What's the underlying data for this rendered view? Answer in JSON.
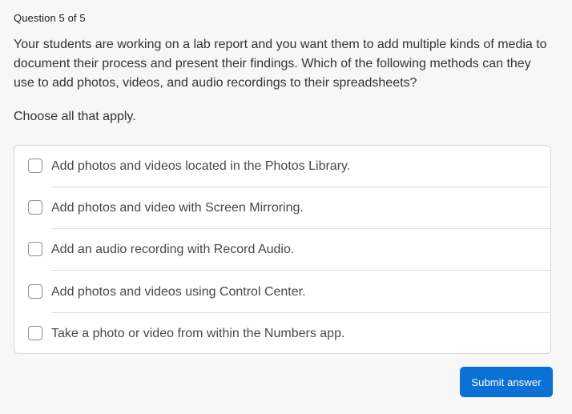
{
  "quiz": {
    "counter": "Question 5 of 5",
    "question": "Your students are working on a lab report and you want them to add multiple kinds of media to document their process and present their findings. Which of the following methods can they use to add photos, videos, and audio recordings to their spreadsheets?",
    "instruction": "Choose all that apply.",
    "options": [
      {
        "label": "Add photos and videos located in the Photos Library.",
        "checked": false
      },
      {
        "label": "Add photos and video with Screen Mirroring.",
        "checked": false
      },
      {
        "label": "Add an audio recording with Record Audio.",
        "checked": false
      },
      {
        "label": "Add photos and videos using Control Center.",
        "checked": false
      },
      {
        "label": "Take a photo or video from within the Numbers app.",
        "checked": false
      }
    ],
    "submit_label": "Submit answer"
  },
  "colors": {
    "accent": "#0b71d6",
    "background": "#f7f7f8",
    "card": "#ffffff",
    "border": "#d8d8dc"
  }
}
